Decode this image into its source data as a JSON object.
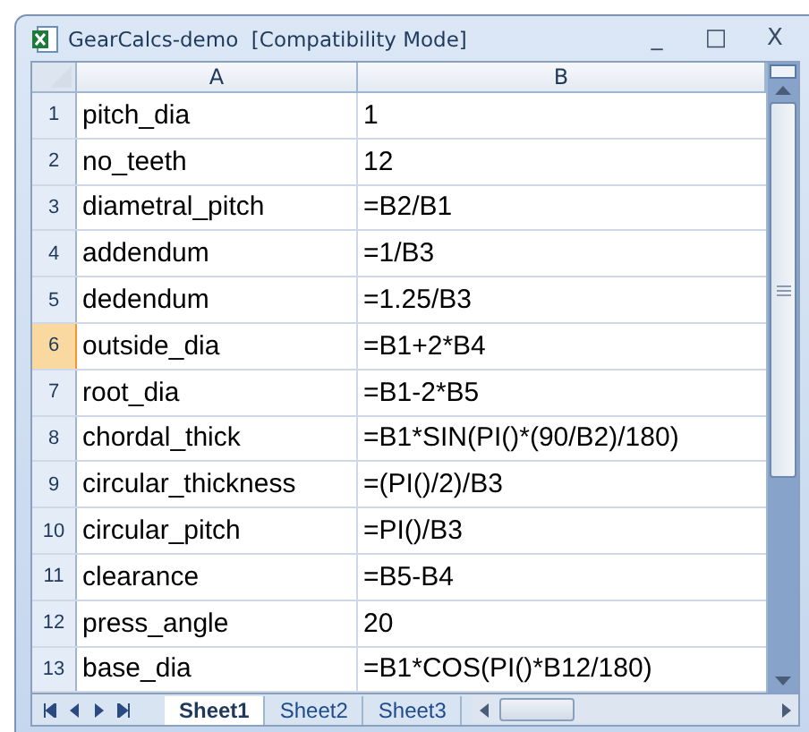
{
  "window": {
    "title": "GearCalcs-demo  [Compatibility Mode]",
    "controls": [
      "_",
      "□",
      "X"
    ]
  },
  "columns": [
    "A",
    "B"
  ],
  "rows": [
    {
      "number": "1",
      "selected": false,
      "a": "pitch_dia",
      "b": "1"
    },
    {
      "number": "2",
      "selected": false,
      "a": "no_teeth",
      "b": "12"
    },
    {
      "number": "3",
      "selected": false,
      "a": "diametral_pitch",
      "b": "=B2/B1"
    },
    {
      "number": "4",
      "selected": false,
      "a": "addendum",
      "b": "=1/B3"
    },
    {
      "number": "5",
      "selected": false,
      "a": "dedendum",
      "b": "=1.25/B3"
    },
    {
      "number": "6",
      "selected": true,
      "a": "outside_dia",
      "b": "=B1+2*B4"
    },
    {
      "number": "7",
      "selected": false,
      "a": "root_dia",
      "b": "=B1-2*B5"
    },
    {
      "number": "8",
      "selected": false,
      "a": "chordal_thick",
      "b": "=B1*SIN(PI()*(90/B2)/180)"
    },
    {
      "number": "9",
      "selected": false,
      "a": "circular_thickness",
      "b": "=(PI()/2)/B3"
    },
    {
      "number": "10",
      "selected": false,
      "a": "circular_pitch",
      "b": "=PI()/B3"
    },
    {
      "number": "11",
      "selected": false,
      "a": "clearance",
      "b": "=B5-B4"
    },
    {
      "number": "12",
      "selected": false,
      "a": "press_angle",
      "b": "20"
    },
    {
      "number": "13",
      "selected": false,
      "a": "base_dia",
      "b": "=B1*COS(PI()*B12/180)"
    }
  ],
  "sheet_tabs": [
    {
      "label": "Sheet1",
      "selected": true
    },
    {
      "label": "Sheet2",
      "selected": false
    },
    {
      "label": "Sheet3",
      "selected": false
    }
  ]
}
